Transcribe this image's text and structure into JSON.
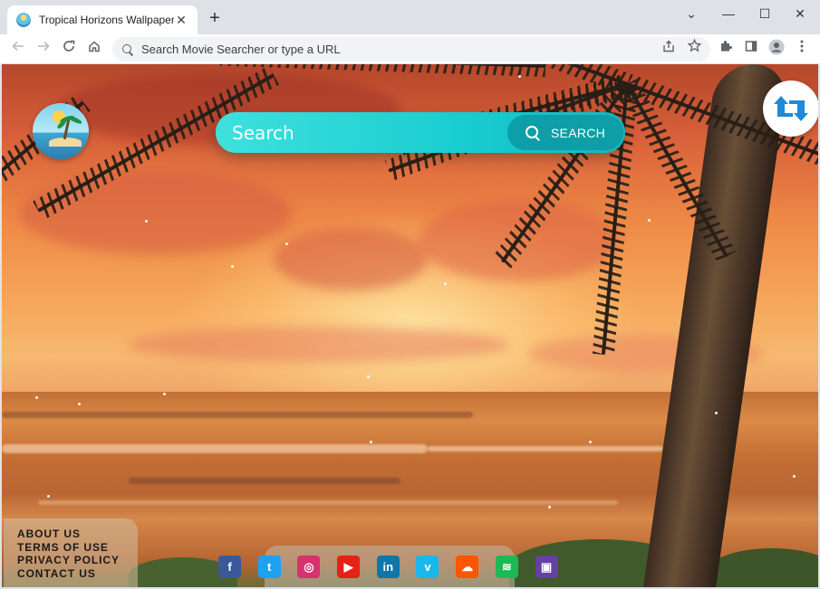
{
  "browser": {
    "tab_title": "Tropical Horizons Wallpapers",
    "tab_close": "✕",
    "new_tab": "+",
    "omnibox_placeholder": "Search Movie Searcher or type a URL",
    "controls": {
      "minimize": "—",
      "maximize": "☐",
      "close": "✕",
      "tab_search": "⌄"
    }
  },
  "page": {
    "search": {
      "placeholder": "Search",
      "button_label": "SEARCH"
    },
    "footer_links": [
      "ABOUT US",
      "TERMS OF USE",
      "PRIVACY POLICY",
      "CONTACT US"
    ],
    "social": [
      {
        "name": "facebook",
        "glyph": "f",
        "color": "#3b5998"
      },
      {
        "name": "twitter",
        "glyph": "t",
        "color": "#1da1f2"
      },
      {
        "name": "instagram",
        "glyph": "◎",
        "color": "#d6336c"
      },
      {
        "name": "youtube",
        "glyph": "▶",
        "color": "#e62117"
      },
      {
        "name": "linkedin",
        "glyph": "in",
        "color": "#0e76a8"
      },
      {
        "name": "vimeo",
        "glyph": "v",
        "color": "#1ab7ea"
      },
      {
        "name": "soundcloud",
        "glyph": "☁",
        "color": "#ff5500"
      },
      {
        "name": "spotify",
        "glyph": "≋",
        "color": "#1db954"
      },
      {
        "name": "twitch",
        "glyph": "▣",
        "color": "#6441a5"
      }
    ],
    "accent": "#19cdd0"
  }
}
